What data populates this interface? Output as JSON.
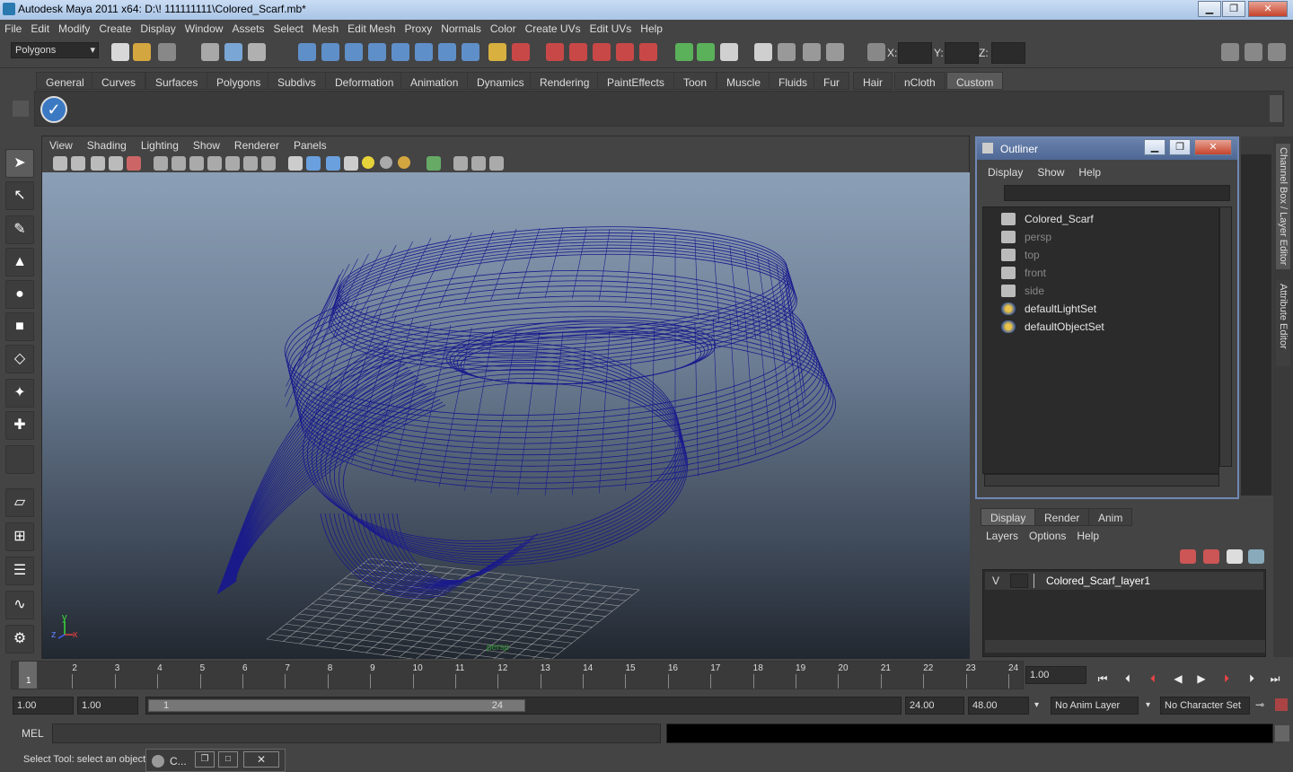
{
  "window": {
    "title": "Autodesk Maya 2011 x64: D:\\! 111111111\\Colored_Scarf.mb*",
    "min": "▁",
    "max": "❐",
    "close": "✕"
  },
  "menubar": [
    "File",
    "Edit",
    "Modify",
    "Create",
    "Display",
    "Window",
    "Assets",
    "Select",
    "Mesh",
    "Edit Mesh",
    "Proxy",
    "Normals",
    "Color",
    "Create UVs",
    "Edit UVs",
    "Help"
  ],
  "statusline": {
    "mode": "Polygons",
    "x_label": "X:",
    "y_label": "Y:",
    "z_label": "Z:"
  },
  "shelf": {
    "tabs": [
      "General",
      "Curves",
      "Surfaces",
      "Polygons",
      "Subdivs",
      "Deformation",
      "Animation",
      "Dynamics",
      "Rendering",
      "PaintEffects",
      "Toon",
      "Muscle",
      "Fluids",
      "Fur",
      "Hair",
      "nCloth",
      "Custom"
    ],
    "active": "Custom"
  },
  "viewport": {
    "menus": [
      "View",
      "Shading",
      "Lighting",
      "Show",
      "Renderer",
      "Panels"
    ],
    "axis_y": "y",
    "axis_z": "z",
    "axis_x": "x",
    "wire_color": "#1a1a8c",
    "ground_label": "persp"
  },
  "outliner": {
    "title": "Outliner",
    "menus": [
      "Display",
      "Show",
      "Help"
    ],
    "items": [
      {
        "name": "Colored_Scarf",
        "icon": "mesh-icon",
        "dim": false
      },
      {
        "name": "persp",
        "icon": "camera-icon",
        "dim": true
      },
      {
        "name": "top",
        "icon": "camera-icon",
        "dim": true
      },
      {
        "name": "front",
        "icon": "camera-icon",
        "dim": true
      },
      {
        "name": "side",
        "icon": "camera-icon",
        "dim": true
      },
      {
        "name": "defaultLightSet",
        "icon": "set-icon",
        "dim": false
      },
      {
        "name": "defaultObjectSet",
        "icon": "set-icon",
        "dim": false
      }
    ]
  },
  "right_tabs": {
    "channel": "Channel Box / Layer Editor",
    "attribute": "Attribute Editor"
  },
  "layers": {
    "tabs": [
      "Display",
      "Render",
      "Anim"
    ],
    "active": "Display",
    "menus": [
      "Layers",
      "Options",
      "Help"
    ],
    "row": {
      "visibility": "V",
      "name": "Colored_Scarf_layer1"
    }
  },
  "timeline": {
    "ticks": [
      "1",
      "2",
      "3",
      "4",
      "5",
      "6",
      "7",
      "8",
      "9",
      "10",
      "11",
      "12",
      "13",
      "14",
      "15",
      "16",
      "17",
      "18",
      "19",
      "20",
      "21",
      "22",
      "23",
      "24"
    ],
    "current": "1",
    "current_time": "1.00"
  },
  "range": {
    "start_anim": "1.00",
    "start": "1.00",
    "slider_start": "1",
    "slider_end": "24",
    "end": "24.00",
    "end_anim": "48.00",
    "anim_layer": "No Anim Layer",
    "char_set": "No Character Set"
  },
  "mel": {
    "label": "MEL"
  },
  "help": {
    "text": "Select Tool: select an object",
    "task_title": "C..."
  }
}
